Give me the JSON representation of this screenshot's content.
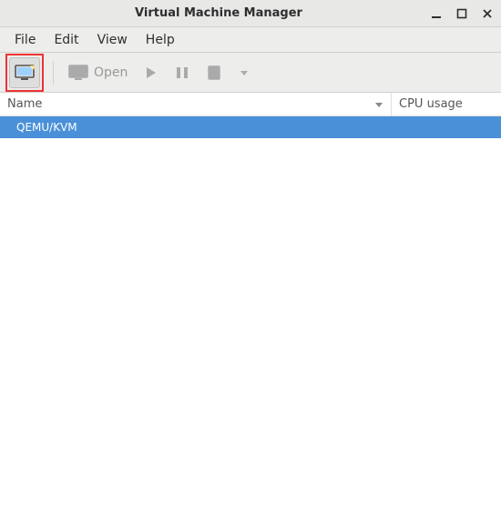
{
  "window": {
    "title": "Virtual Machine Manager"
  },
  "menu": {
    "file": "File",
    "edit": "Edit",
    "view": "View",
    "help": "Help"
  },
  "toolbar": {
    "open_label": "Open"
  },
  "columns": {
    "name": "Name",
    "cpu": "CPU usage"
  },
  "connections": [
    {
      "label": "QEMU/KVM"
    }
  ]
}
